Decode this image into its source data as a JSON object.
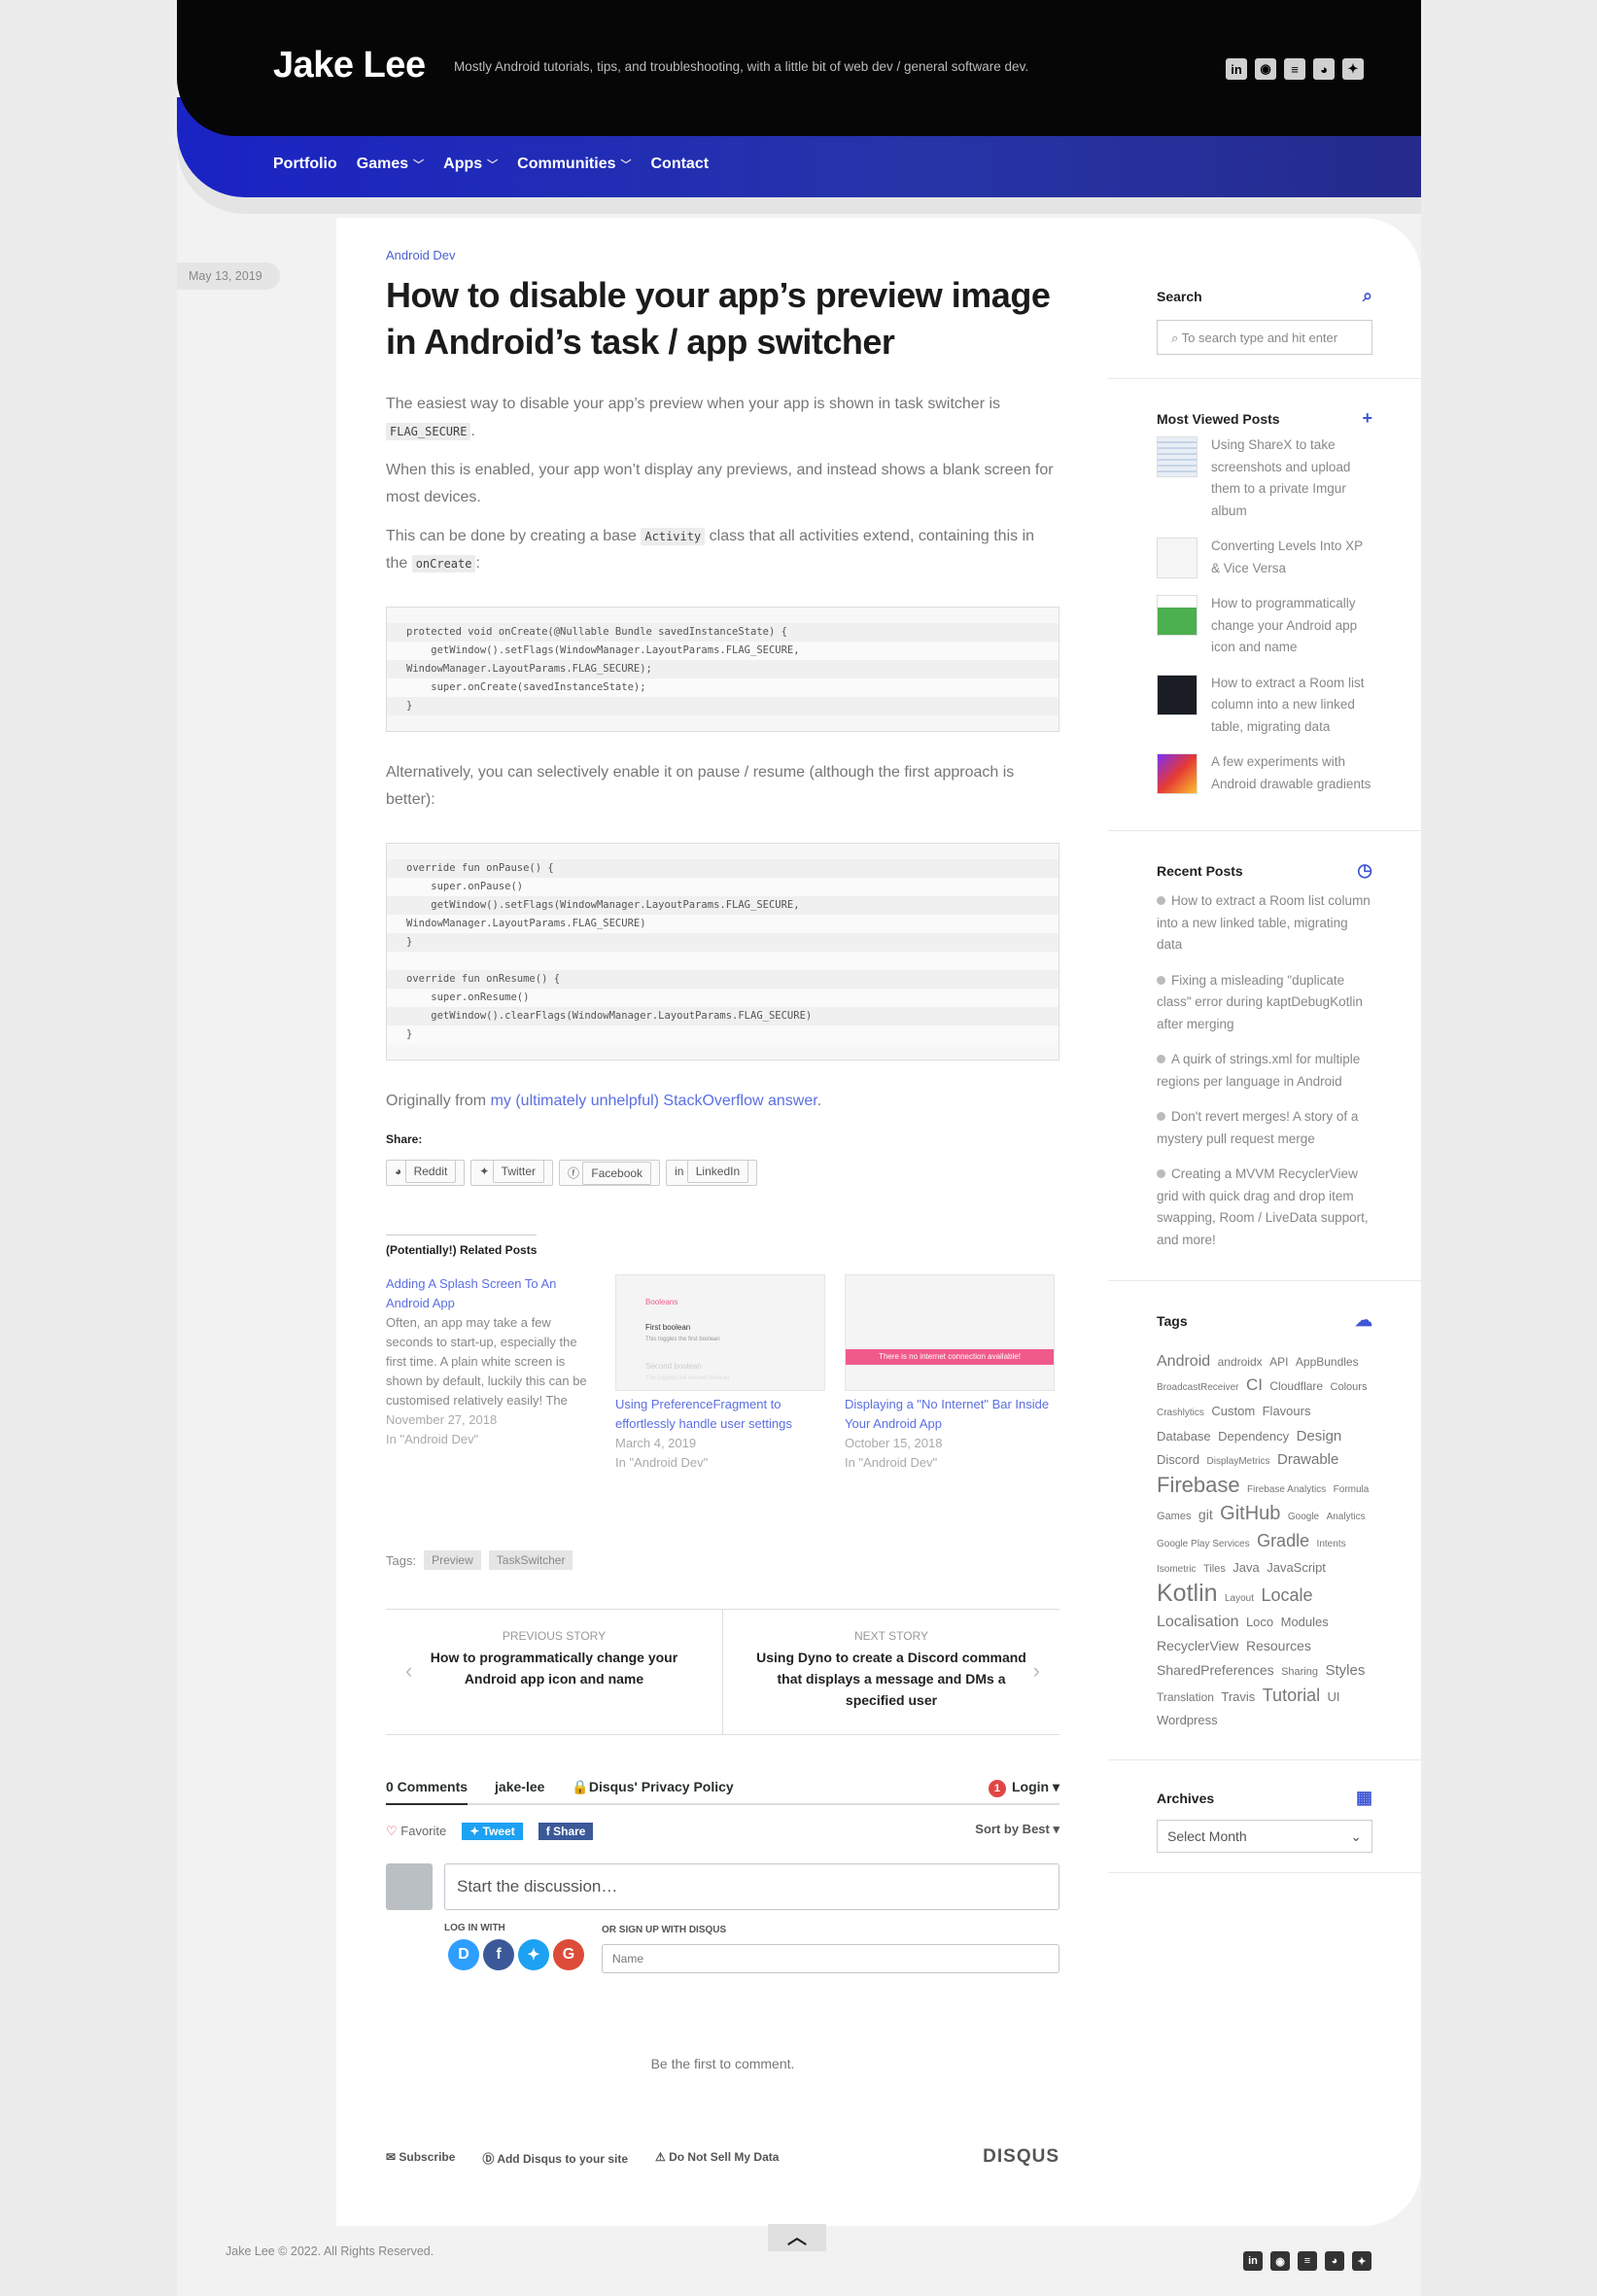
{
  "site": {
    "title": "Jake Lee",
    "tagline": "Mostly Android tutorials, tips, and troubleshooting, with a little bit of web dev / general software dev."
  },
  "social_icons": [
    "linkedin-icon",
    "github-icon",
    "stackoverflow-icon",
    "reddit-icon",
    "twitter-icon"
  ],
  "nav": {
    "items": [
      {
        "label": "Portfolio",
        "dropdown": false
      },
      {
        "label": "Games",
        "dropdown": true
      },
      {
        "label": "Apps",
        "dropdown": true
      },
      {
        "label": "Communities",
        "dropdown": true
      },
      {
        "label": "Contact",
        "dropdown": false
      }
    ]
  },
  "post": {
    "date": "May 13, 2019",
    "category": "Android Dev",
    "title": "How to disable your app’s preview image in Android’s task / app switcher",
    "p1_pre": "The easiest way to disable your app’s preview when your app is shown in task switcher is ",
    "p1_code": "FLAG_SECURE",
    "p1_post": ".",
    "p2": "When this is enabled, your app won’t display any previews, and instead shows a blank screen for most devices.",
    "p3_a": "This can be done by creating a base ",
    "p3_code1": "Activity",
    "p3_b": " class that all activities extend, containing this in the ",
    "p3_code2": "onCreate",
    "p3_c": ":",
    "code1": [
      "protected void onCreate(@Nullable Bundle savedInstanceState) {",
      "    getWindow().setFlags(WindowManager.LayoutParams.FLAG_SECURE,",
      "WindowManager.LayoutParams.FLAG_SECURE);",
      "    super.onCreate(savedInstanceState);",
      "}"
    ],
    "p4": "Alternatively, you can selectively enable it on pause / resume (although the first approach is better):",
    "code2": [
      "override fun onPause() {",
      "    super.onPause()",
      "    getWindow().setFlags(WindowManager.LayoutParams.FLAG_SECURE,",
      "WindowManager.LayoutParams.FLAG_SECURE)",
      "}",
      "",
      "override fun onResume() {",
      "    super.onResume()",
      "    getWindow().clearFlags(WindowManager.LayoutParams.FLAG_SECURE)",
      "}"
    ],
    "p5_pre": "Originally from ",
    "p5_link": "my (ultimately unhelpful) StackOverflow answer",
    "p5_post": "."
  },
  "share": {
    "label": "Share:",
    "buttons": [
      "Reddit",
      "Twitter",
      "Facebook",
      "LinkedIn"
    ]
  },
  "related": {
    "heading": "(Potentially!) Related Posts",
    "items": [
      {
        "title": "Adding A Splash Screen To An Android App",
        "excerpt": "Often, an app may take a few seconds to start-up, especially the first time. A plain white screen is shown by default, luckily this can be customised relatively easily! The",
        "date": "November 27, 2018",
        "cat": "In \"Android Dev\""
      },
      {
        "title": "Using PreferenceFragment to effortlessly handle user settings",
        "excerpt": "",
        "date": "March 4, 2019",
        "cat": "In \"Android Dev\"",
        "img_label": "Booleans",
        "img_row1": "First boolean",
        "img_row1_sub": "This toggles the first boolean",
        "img_row2": "Second boolean",
        "img_row2_sub": "This toggles the second boolean"
      },
      {
        "title": "Displaying a \"No Internet\" Bar Inside Your Android App",
        "excerpt": "",
        "date": "October 15, 2018",
        "cat": "In \"Android Dev\"",
        "img_bar": "There is no internet connection available!"
      }
    ]
  },
  "tags": {
    "label": "Tags:",
    "items": [
      "Preview",
      "TaskSwitcher"
    ]
  },
  "story_nav": {
    "prev_label": "PREVIOUS STORY",
    "prev_title": "How to programmatically change your Android app icon and name",
    "next_label": "NEXT STORY",
    "next_title": "Using Dyno to create a Discord command that displays a message and DMs a specified user"
  },
  "disqus": {
    "comments_tab": "0 Comments",
    "site_tab": "jake-lee",
    "privacy": "Disqus' Privacy Policy",
    "notif_count": "1",
    "login": "Login",
    "favorite": "Favorite",
    "tweet": "Tweet",
    "share": "Share",
    "sort": "Sort by Best",
    "placeholder": "Start the discussion…",
    "login_with": "LOG IN WITH",
    "signup_with": "OR SIGN UP WITH DISQUS",
    "name_placeholder": "Name",
    "first": "Be the first to comment.",
    "subscribe": "Subscribe",
    "add_disqus": "Add Disqus to your site",
    "do_not_sell": "Do Not Sell My Data",
    "brand": "DISQUS"
  },
  "sidebar": {
    "search_title": "Search",
    "search_placeholder": "To search type and hit enter",
    "most_viewed_title": "Most Viewed Posts",
    "most_viewed": [
      "Using ShareX to take screenshots and upload them to a private Imgur album",
      "Converting Levels Into XP & Vice Versa",
      "How to programmatically change your Android app icon and name",
      "How to extract a Room list column into a new linked table, migrating data",
      "A few experiments with Android drawable gradients"
    ],
    "recent_title": "Recent Posts",
    "recent": [
      "How to extract a Room list column into a new linked table, migrating data",
      "Fixing a misleading \"duplicate class\" error during kaptDebugKotlin after merging",
      "A quirk of strings.xml for multiple regions per language in Android",
      "Don't revert merges! A story of a mystery pull request merge",
      "Creating a MVVM RecyclerView grid with quick drag and drop item swapping, Room / LiveData support, and more!"
    ],
    "tags_title": "Tags",
    "tag_cloud": [
      {
        "t": "Android",
        "s": 16
      },
      {
        "t": "androidx",
        "s": 12
      },
      {
        "t": "API",
        "s": 12
      },
      {
        "t": "AppBundles",
        "s": 12
      },
      {
        "t": "BroadcastReceiver",
        "s": 10
      },
      {
        "t": "CI",
        "s": 17
      },
      {
        "t": "Cloudflare",
        "s": 12
      },
      {
        "t": "Colours",
        "s": 11
      },
      {
        "t": "Crashlytics",
        "s": 10
      },
      {
        "t": "Custom",
        "s": 13
      },
      {
        "t": "Flavours",
        "s": 13
      },
      {
        "t": "Database",
        "s": 13
      },
      {
        "t": "Dependency",
        "s": 13
      },
      {
        "t": "Design",
        "s": 15
      },
      {
        "t": "Discord",
        "s": 13
      },
      {
        "t": "DisplayMetrics",
        "s": 10
      },
      {
        "t": "Drawable",
        "s": 15
      },
      {
        "t": "Firebase",
        "s": 22
      },
      {
        "t": "Firebase Analytics",
        "s": 10
      },
      {
        "t": "Formula",
        "s": 10
      },
      {
        "t": "Games",
        "s": 11
      },
      {
        "t": "git",
        "s": 14
      },
      {
        "t": "GitHub",
        "s": 20
      },
      {
        "t": "Google",
        "s": 10
      },
      {
        "t": "Analytics",
        "s": 10
      },
      {
        "t": "Google Play Services",
        "s": 10
      },
      {
        "t": "Gradle",
        "s": 18
      },
      {
        "t": "Intents",
        "s": 10
      },
      {
        "t": "Isometric",
        "s": 10
      },
      {
        "t": "Tiles",
        "s": 11
      },
      {
        "t": "Java",
        "s": 13
      },
      {
        "t": "JavaScript",
        "s": 13
      },
      {
        "t": "Kotlin",
        "s": 25
      },
      {
        "t": "Layout",
        "s": 10
      },
      {
        "t": "Locale",
        "s": 18
      },
      {
        "t": "Localisation",
        "s": 16
      },
      {
        "t": "Loco",
        "s": 13
      },
      {
        "t": "Modules",
        "s": 13
      },
      {
        "t": "RecyclerView",
        "s": 14
      },
      {
        "t": "Resources",
        "s": 14
      },
      {
        "t": "SharedPreferences",
        "s": 14
      },
      {
        "t": "Sharing",
        "s": 11
      },
      {
        "t": "Styles",
        "s": 15
      },
      {
        "t": "Translation",
        "s": 12
      },
      {
        "t": "Travis",
        "s": 13
      },
      {
        "t": "Tutorial",
        "s": 18
      },
      {
        "t": "UI",
        "s": 13
      },
      {
        "t": "Wordpress",
        "s": 13
      }
    ],
    "archives_title": "Archives",
    "archives_select": "Select Month"
  },
  "footer": {
    "copyright": "Jake Lee © 2022. All Rights Reserved.",
    "to_top": "︿"
  },
  "colors": {
    "accent": "#3f56d4",
    "header_bg": "#060606",
    "nav_bg": "#1f2bb3"
  }
}
